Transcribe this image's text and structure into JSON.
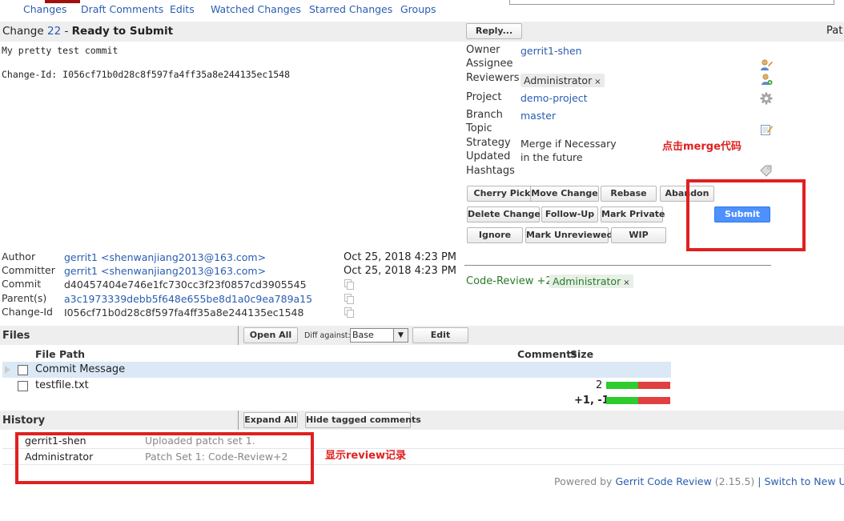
{
  "nav": {
    "items": [
      "Changes",
      "Draft Comments",
      "Edits",
      "Watched Changes",
      "Starred Changes",
      "Groups"
    ]
  },
  "change": {
    "prefix": "Change",
    "number": "22",
    "separator": "-",
    "status": "Ready to Submit",
    "reply_label": "Reply...",
    "patch_label": "Pat"
  },
  "commit_message": "My pretty test commit\n\nChange-Id: I056cf71b0d28c8f597fa4ff35a8e244135ec1548",
  "info": {
    "owner_label": "Owner",
    "owner": "gerrit1-shen",
    "assignee_label": "Assignee",
    "reviewers_label": "Reviewers",
    "reviewer": "Administrator",
    "project_label": "Project",
    "project": "demo-project",
    "branch_label": "Branch",
    "branch": "master",
    "topic_label": "Topic",
    "strategy_label": "Strategy",
    "strategy": "Merge if Necessary",
    "updated_label": "Updated",
    "updated": "in the future",
    "hashtags_label": "Hashtags",
    "remove_glyph": "×"
  },
  "actions": {
    "cherry_pick": "Cherry Pick",
    "move_change": "Move Change",
    "rebase": "Rebase",
    "abandon": "Abandon",
    "delete_change": "Delete Change",
    "follow_up": "Follow-Up",
    "mark_private": "Mark Private",
    "ignore": "Ignore",
    "mark_unreviewed": "Mark Unreviewed",
    "wip": "WIP",
    "submit": "Submit"
  },
  "annotations": {
    "merge": "点击merge代码",
    "review": "显示review记录"
  },
  "commit_info": {
    "author_label": "Author",
    "author": "gerrit1 <shenwanjiang2013@163.com>",
    "author_date": "Oct 25, 2018 4:23 PM",
    "committer_label": "Committer",
    "committer": "gerrit1 <shenwanjiang2013@163.com>",
    "committer_date": "Oct 25, 2018 4:23 PM",
    "commit_label": "Commit",
    "commit": "d40457404e746e1fc730cc3f23f0857cd3905545",
    "parent_label": "Parent(s)",
    "parent": "a3c1973339debb5f648e655be8d1a0c9ea789a15",
    "changeid_label": "Change-Id",
    "changeid": "I056cf71b0d28c8f597fa4ff35a8e244135ec1548"
  },
  "vote": {
    "label": "Code-Review",
    "value": "+2",
    "user": "Administrator"
  },
  "files": {
    "title": "Files",
    "open_all": "Open All",
    "diff_against_label": "Diff against:",
    "diff_against_value": "Base",
    "edit": "Edit",
    "col_path": "File Path",
    "col_comments": "Comments",
    "col_size": "Size",
    "rows": [
      {
        "name": "Commit Message",
        "size": ""
      },
      {
        "name": "testfile.txt",
        "size": "2",
        "added_fraction": 0.5
      }
    ],
    "total": "+1, -1",
    "total_added_fraction": 0.5,
    "colors": {
      "added": "#2ecc2e",
      "removed": "#e04040"
    }
  },
  "history": {
    "title": "History",
    "expand_all": "Expand All",
    "hide_tagged": "Hide tagged comments",
    "rows": [
      {
        "name": "gerrit1-shen",
        "message": "Uploaded patch set 1."
      },
      {
        "name": "Administrator",
        "message": "Patch Set 1: Code-Review+2"
      }
    ]
  },
  "footer": {
    "powered_by": "Powered by",
    "product": "Gerrit Code Review",
    "version": "(2.15.5)",
    "sep1": "|",
    "switch": "Switch to New UI",
    "sep2": "|"
  },
  "icons": {
    "assignee": "edit-person-icon",
    "reviewers": "add-person-icon",
    "project": "gear-icon",
    "topic": "edit-icon",
    "hashtags": "tag-icon",
    "copy": "copy-icon",
    "expand": "expand-triangle-icon",
    "dropdown": "chevron-down-icon"
  },
  "colors": {
    "accent": "#2a5db0",
    "submit": "#4d90fe",
    "annotation": "#e02020",
    "vote": "#2a7a2a"
  }
}
